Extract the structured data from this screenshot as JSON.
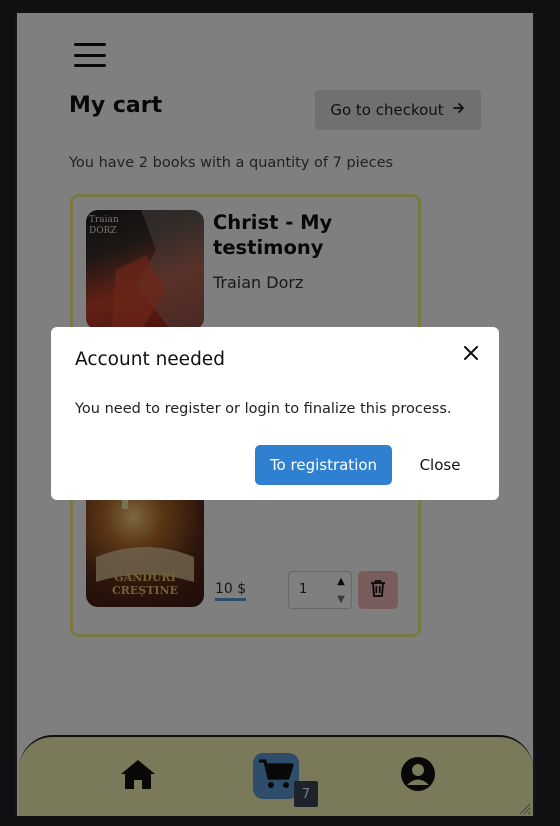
{
  "header": {
    "title": "My cart",
    "checkout_label": "Go to checkout"
  },
  "summary": "You have 2 books with a quantity of 7 pieces",
  "items": [
    {
      "title": "Christ - My testimony",
      "author": "Traian Dorz",
      "cover_text": "Traian\nDORZ"
    },
    {
      "cover_text": "GÂNDURI CREȘTINE",
      "price": "10 $",
      "quantity": "1"
    }
  ],
  "bottom_nav": {
    "cart_count": "7",
    "bar_color": "#f5f2b5",
    "active_color": "#5b9bd5",
    "icons": [
      "home-icon",
      "cart-icon",
      "user-circle-icon"
    ]
  },
  "modal": {
    "title": "Account needed",
    "body": "You need to register or login to finalize this process.",
    "primary_label": "To registration",
    "secondary_label": "Close",
    "primary_color": "#2f80d1"
  },
  "colors": {
    "cart_border": "#f1f38a",
    "delete_bg": "#f2b8b8",
    "checkout_bg": "#dfe0e4"
  }
}
